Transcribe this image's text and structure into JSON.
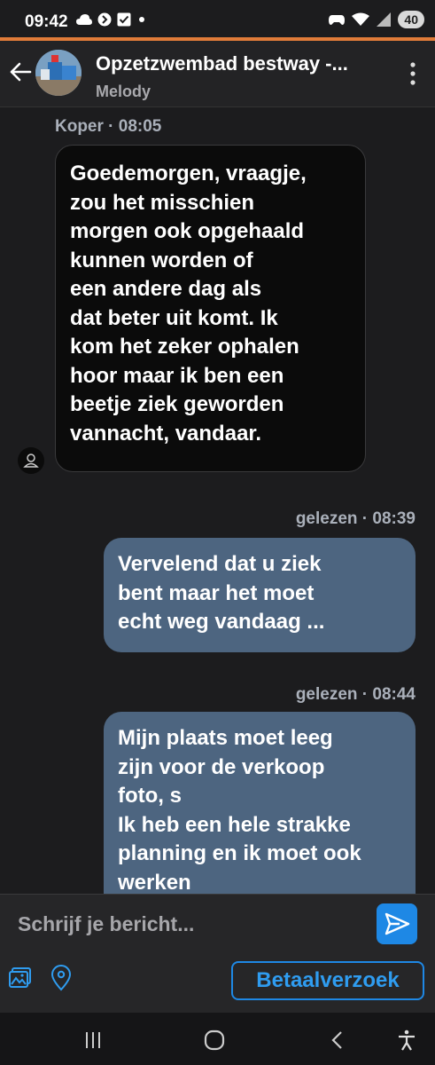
{
  "status_bar": {
    "time": "09:42",
    "battery": "40",
    "left_icons": [
      "cloud-icon",
      "dot-circle-icon",
      "check-box-icon",
      "dot-icon"
    ],
    "right_icons": [
      "gamepad-icon",
      "wifi-icon",
      "signal-icon"
    ]
  },
  "colors": {
    "accent_line": "#e07b39",
    "outgoing_bubble": "#4d6580",
    "incoming_bubble": "#0b0b0b",
    "link_blue": "#1e88e5"
  },
  "header": {
    "title": "Opzetzwembad bestway -...",
    "subtitle": "Melody"
  },
  "messages": [
    {
      "direction": "incoming",
      "meta": "Koper · 08:05",
      "text": "Goedemorgen, vraagje,\nzou het misschien\nmorgen ook opgehaald\nkunnen worden of\neen andere dag als\ndat beter uit komt. Ik\nkom het zeker ophalen\nhoor maar ik ben een\nbeetje ziek geworden\nvannacht, vandaar."
    },
    {
      "direction": "outgoing",
      "meta": "gelezen · 08:39",
      "text": "Vervelend dat u ziek\nbent maar het moet\necht weg vandaag ..."
    },
    {
      "direction": "outgoing",
      "meta": "gelezen · 08:44",
      "text": "Mijn plaats moet leeg\nzijn voor de verkoop\nfoto, s\nIk heb een hele strakke\nplanning en ik moet ook\nwerken"
    }
  ],
  "composer": {
    "placeholder": "Schrijf je bericht..."
  },
  "actions": {
    "payment_request": "Betaalverzoek"
  }
}
